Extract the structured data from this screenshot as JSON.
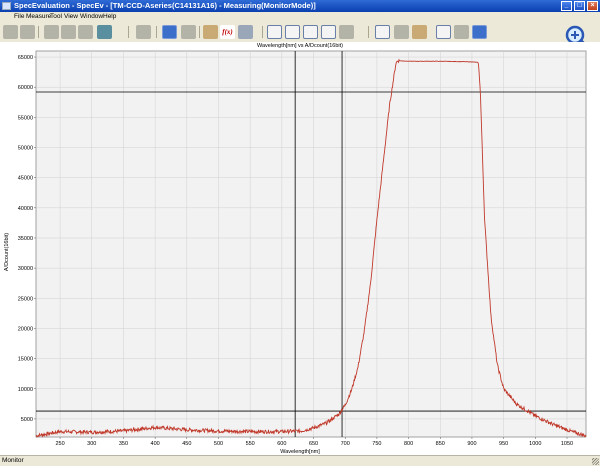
{
  "window": {
    "title": "SpecEvaluation - SpecEv - [TM-CCD-Aseries(C14131A16) - Measuring(MonitorMode)]",
    "buttons": [
      "_",
      "□",
      "×"
    ]
  },
  "menu": [
    "File",
    "Measure",
    "Tool",
    "View",
    "Window",
    "Help"
  ],
  "toolbar": {
    "function_label": "f(x)"
  },
  "status": {
    "text": "Monitor"
  },
  "colors": {
    "curve": "#c0392b",
    "cursor_lines": "#000000",
    "grid": "#d0d0d0",
    "plot_background": "#f2f2f2"
  },
  "chart_data": {
    "type": "line",
    "title": "Wavelength[nm] vs A/Dcount(16bit)",
    "xlabel": "Wavelength[nm]",
    "ylabel": "A/Dcount(16bit)",
    "xlim": [
      212,
      1080
    ],
    "ylim": [
      2000,
      66000
    ],
    "xticks": [
      250,
      300,
      350,
      400,
      450,
      500,
      550,
      600,
      650,
      700,
      750,
      800,
      850,
      900,
      950,
      1000,
      1050
    ],
    "yticks": [
      5000,
      10000,
      15000,
      20000,
      25000,
      30000,
      35000,
      40000,
      45000,
      50000,
      55000,
      60000,
      65000
    ],
    "grid": true,
    "cursors": {
      "vertical": [
        621,
        695
      ],
      "horizontal": [
        59200,
        6300
      ]
    },
    "series": [
      {
        "x": [
          212,
          250,
          300,
          350,
          400,
          450,
          500,
          550,
          600,
          630,
          650,
          670,
          690,
          700,
          710,
          720,
          730,
          740,
          750,
          760,
          770,
          780,
          783,
          800,
          850,
          900,
          910,
          913,
          920,
          930,
          940,
          950,
          970,
          1000,
          1030,
          1060,
          1080
        ],
        "y": [
          2200,
          2900,
          2800,
          3000,
          3600,
          3200,
          3000,
          2900,
          2900,
          3000,
          3500,
          4300,
          5800,
          7300,
          9800,
          13500,
          19500,
          27500,
          38000,
          47500,
          57000,
          64000,
          64400,
          64300,
          64300,
          64200,
          64100,
          60000,
          38000,
          22000,
          14000,
          10000,
          7500,
          5500,
          4000,
          2800,
          2200
        ]
      }
    ]
  }
}
